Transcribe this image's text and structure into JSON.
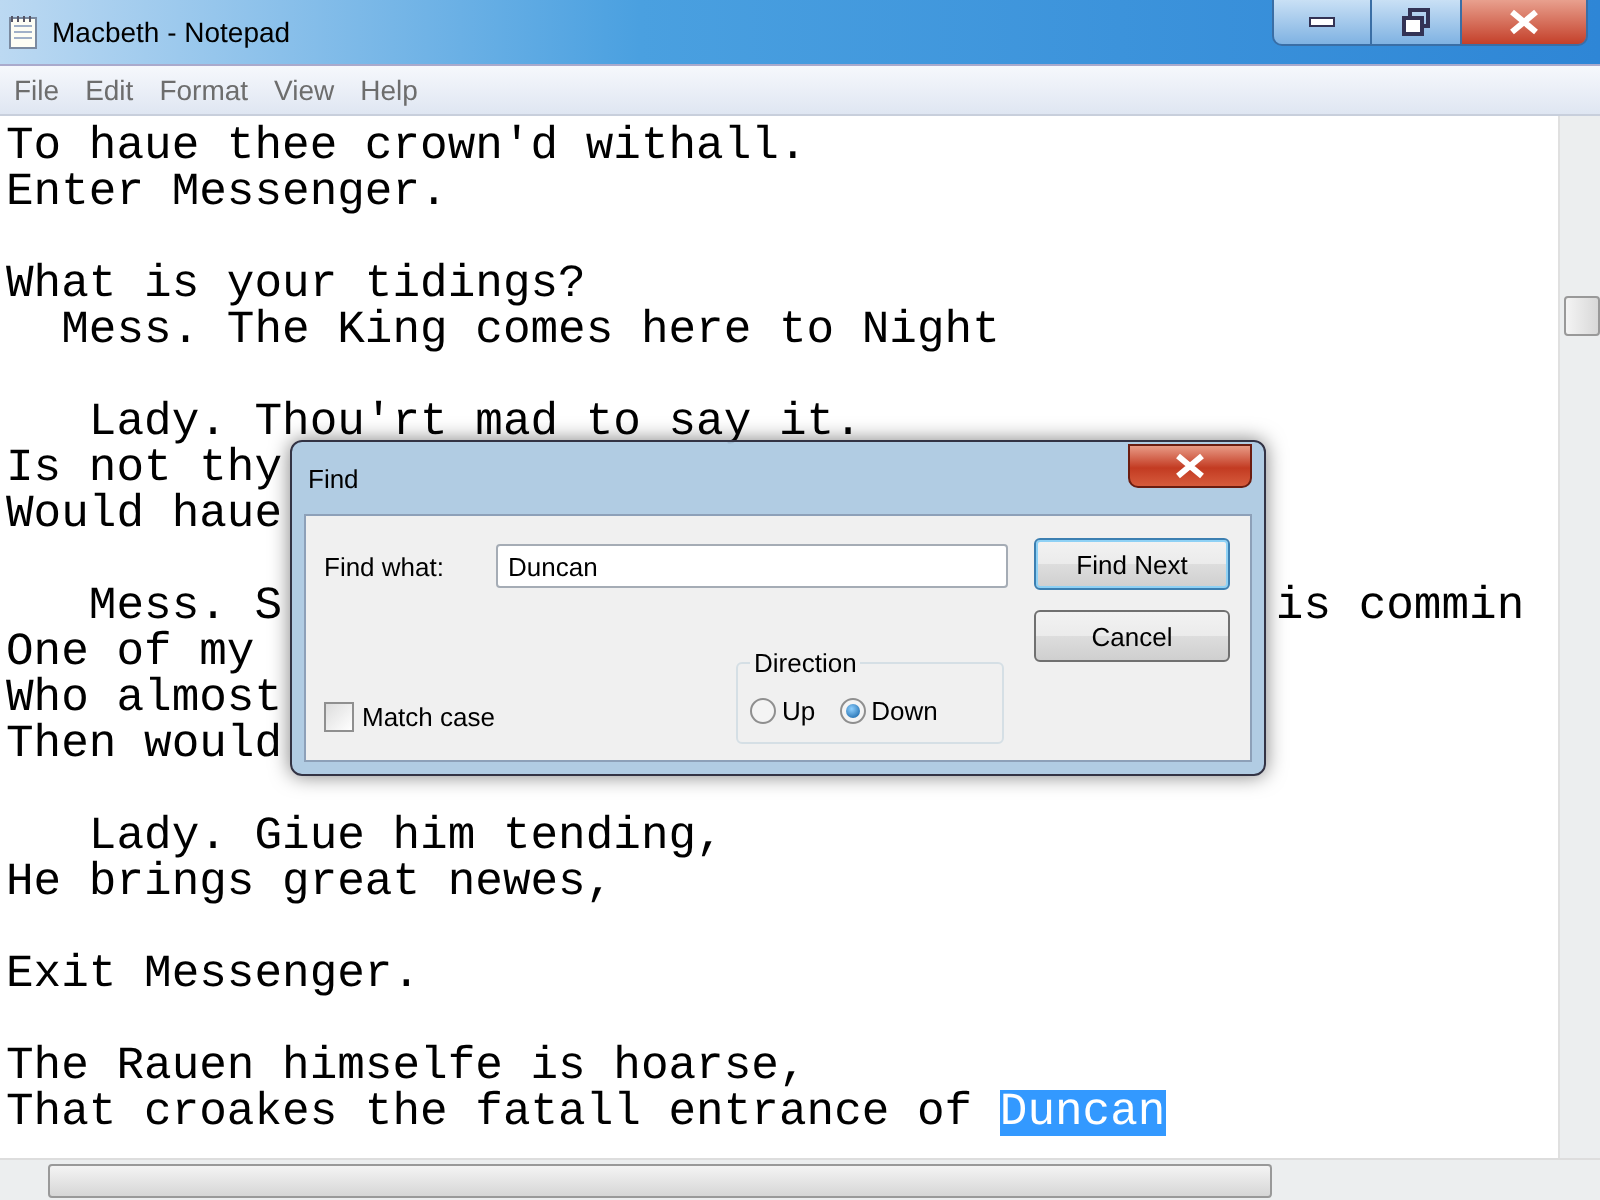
{
  "window": {
    "title": "Macbeth - Notepad"
  },
  "menu": [
    "File",
    "Edit",
    "Format",
    "View",
    "Help"
  ],
  "paragraphs": [
    {
      "lines": [
        {
          "segments": [
            {
              "text": "To haue thee crown'd withall.",
              "selected": false
            }
          ]
        },
        {
          "segments": [
            {
              "text": "Enter Messenger.",
              "selected": false
            }
          ]
        }
      ]
    },
    {
      "lines": [
        {
          "segments": [
            {
              "text": "What is your tidings?",
              "selected": false
            }
          ]
        },
        {
          "segments": [
            {
              "text": "  Mess. The King comes here to Night",
              "selected": false
            }
          ]
        }
      ]
    },
    {
      "lines": [
        {
          "segments": [
            {
              "text": "   Lady. Thou'rt mad to say it.",
              "selected": false
            }
          ]
        },
        {
          "segments": [
            {
              "text": "Is not thy",
              "selected": false
            }
          ]
        },
        {
          "segments": [
            {
              "text": "Would haue",
              "selected": false
            }
          ]
        }
      ]
    },
    {
      "lines": [
        {
          "segments": [
            {
              "text": "   Mess. S",
              "selected": false
            }
          ],
          "far_text": "is commin"
        },
        {
          "segments": [
            {
              "text": "One of my",
              "selected": false
            }
          ]
        },
        {
          "segments": [
            {
              "text": "Who almost",
              "selected": false
            }
          ]
        },
        {
          "segments": [
            {
              "text": "Then would",
              "selected": false
            }
          ]
        }
      ]
    },
    {
      "lines": [
        {
          "segments": [
            {
              "text": "   Lady. Giue him tending,",
              "selected": false
            }
          ]
        },
        {
          "segments": [
            {
              "text": "He brings great newes,",
              "selected": false
            }
          ]
        }
      ]
    },
    {
      "lines": [
        {
          "segments": [
            {
              "text": "Exit Messenger.",
              "selected": false
            }
          ]
        }
      ]
    },
    {
      "lines": [
        {
          "segments": [
            {
              "text": "The Rauen himselfe is hoarse,",
              "selected": false
            }
          ]
        },
        {
          "segments": [
            {
              "text": "That croakes the fatall entrance of ",
              "selected": false
            },
            {
              "text": "Duncan",
              "selected": true
            }
          ]
        }
      ]
    }
  ],
  "find_dialog": {
    "title": "Find",
    "find_what_label": "Find what:",
    "find_what_value": "Duncan",
    "match_case": {
      "label": "Match case",
      "checked": false
    },
    "direction": {
      "label": "Direction",
      "options": [
        {
          "label": "Up",
          "selected": false
        },
        {
          "label": "Down",
          "selected": true
        }
      ]
    },
    "buttons": [
      {
        "label": "Find Next",
        "default": true
      },
      {
        "label": "Cancel",
        "default": false
      }
    ]
  }
}
